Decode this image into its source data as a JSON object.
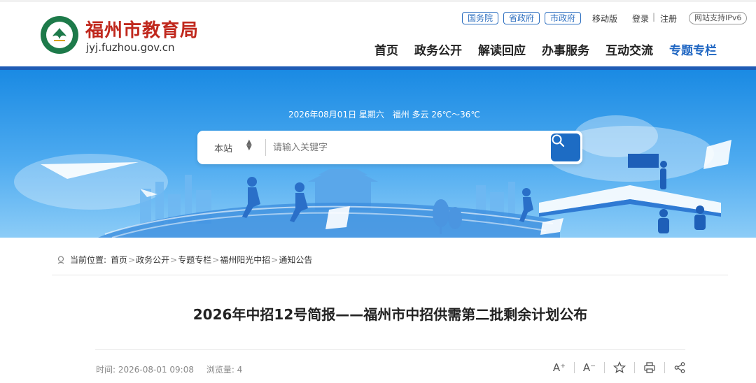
{
  "header": {
    "logo_title": "福州市教育局",
    "logo_url": "jyj.fuzhou.gov.cn",
    "gov_links": [
      "国务院",
      "省政府",
      "市政府"
    ],
    "mobile": "移动版",
    "login": "登录",
    "register": "注册",
    "ipv6": "网站支持IPv6",
    "nav": [
      "首页",
      "政务公开",
      "解读回应",
      "办事服务",
      "互动交流",
      "专题专栏"
    ]
  },
  "banner": {
    "date": "2026年08月01日 星期六",
    "weather": "福州 多云 26℃～36℃",
    "search": {
      "scope": "本站",
      "placeholder": "请输入关键字"
    }
  },
  "breadcrumb": {
    "label": "当前位置:",
    "items": [
      "首页",
      "政务公开",
      "专题专栏",
      "福州阳光中招",
      "通知公告"
    ]
  },
  "article": {
    "title": "2026年中招12号简报——福州市中招供需第二批剩余计划公布",
    "time": "时间: 2026-08-01 09:08",
    "views": "浏览量: 4"
  },
  "tools": {
    "font_up": "A⁺",
    "font_down": "A⁻"
  },
  "colors": {
    "brand_red": "#c0281d",
    "nav_active": "#1f66c2",
    "bar_blue": "#1e5bb5",
    "search_btn": "#1d6cc4"
  }
}
